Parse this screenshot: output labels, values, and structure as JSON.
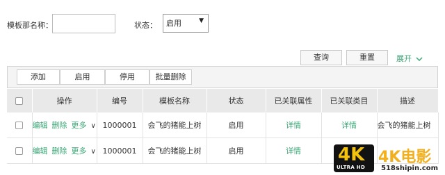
{
  "filters": {
    "template_name_label": "模板那名称：",
    "template_name_value": "",
    "status_label": "状态：",
    "status_value": "启用"
  },
  "actions": {
    "query_label": "查询",
    "reset_label": "重置",
    "expand_label": "展开"
  },
  "toolbar": {
    "add_label": "添加",
    "enable_label": "启用",
    "disable_label": "停用",
    "batch_delete_label": "批量删除"
  },
  "table": {
    "headers": [
      "操作",
      "编号",
      "模板名称",
      "状态",
      "已关联属性",
      "已关联类目",
      "描述"
    ],
    "rows": [
      {
        "edit": "编辑",
        "delete": "删除",
        "more": "更多",
        "id": "1000001",
        "name": "会飞的猪能上树",
        "status": "启用",
        "attrs": "详情",
        "cats": "详情",
        "desc": "会飞的猪能上树"
      },
      {
        "edit": "编辑",
        "delete": "删除",
        "more": "更多",
        "id": "1000001",
        "name": "会飞的猪能上树",
        "status": "启用",
        "attrs": "详情",
        "cats": "",
        "desc": ""
      }
    ]
  },
  "watermark": {
    "badge": "4K",
    "badge_sub": "ULTRA HD",
    "brand": "4K电影",
    "url": "518shipin.com"
  }
}
